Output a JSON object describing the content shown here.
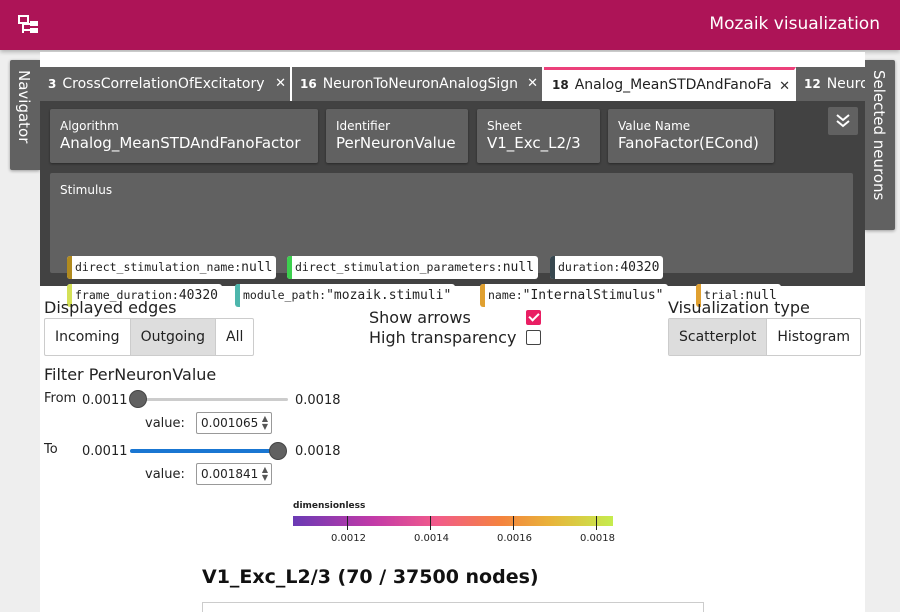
{
  "appbar": {
    "title": "Mozaik visualization",
    "menu_icon": "sitemap-icon",
    "color": "#ad1457"
  },
  "side_tabs": {
    "navigator": "Navigator",
    "selected_neurons": "Selected neurons"
  },
  "tabs": [
    {
      "num": "3",
      "label": "CrossCorrelationOfExcitatory",
      "active": false
    },
    {
      "num": "16",
      "label": "NeuronToNeuronAnalogSign",
      "active": false
    },
    {
      "num": "18",
      "label": "Analog_MeanSTDAndFanoFa",
      "active": true
    },
    {
      "num": "12",
      "label": "Neuro",
      "active": false
    }
  ],
  "info": {
    "algorithm": {
      "label": "Algorithm",
      "value": "Analog_MeanSTDAndFanoFactor"
    },
    "identifier": {
      "label": "Identifier",
      "value": "PerNeuronValue"
    },
    "sheet": {
      "label": "Sheet",
      "value": "V1_Exc_L2/3"
    },
    "value_name": {
      "label": "Value Name",
      "value": "FanoFactor(ECond)"
    },
    "stimulus": {
      "label": "Stimulus",
      "params": [
        {
          "key": "direct_stimulation_name:",
          "value": "null",
          "color": "#b08a1e"
        },
        {
          "key": "direct_stimulation_parameters:",
          "value": "null",
          "color": "#3ccf4e"
        },
        {
          "key": "duration:",
          "value": "40320",
          "color": "#37474f"
        },
        {
          "key": "frame_duration:",
          "value": "40320",
          "color": "#d4e157"
        },
        {
          "key": "module_path:",
          "value": "\"mozaik.stimuli\"",
          "color": "#4db6ac"
        },
        {
          "key": "name:",
          "value": "\"InternalStimulus\"",
          "color": "#e0a030"
        },
        {
          "key": "trial:",
          "value": "null",
          "color": "#e0a030"
        }
      ]
    }
  },
  "controls": {
    "displayed_edges": {
      "label": "Displayed edges",
      "options": [
        "Incoming",
        "Outgoing",
        "All"
      ],
      "selected": "Outgoing"
    },
    "show_arrows": {
      "label": "Show arrows",
      "checked": true
    },
    "high_transparency": {
      "label": "High transparency",
      "checked": false
    },
    "visualization_type": {
      "label": "Visualization type",
      "options": [
        "Scatterplot",
        "Histogram"
      ],
      "selected": "Scatterplot"
    },
    "filter": {
      "label": "Filter PerNeuronValue",
      "from": {
        "label": "From",
        "min": "0.0011",
        "max": "0.0018",
        "value_label": "value:",
        "value": "0.001065",
        "level": 0.0
      },
      "to": {
        "label": "To",
        "min": "0.0011",
        "max": "0.0018",
        "value_label": "value:",
        "value": "0.001841",
        "level": 1.0
      }
    }
  },
  "colorbar": {
    "title": "dimensionless",
    "ticks": [
      "0.0012",
      "0.0014",
      "0.0016",
      "0.0018"
    ]
  },
  "graph": {
    "title": "V1_Exc_L2/3 (70 / 37500 nodes)"
  }
}
